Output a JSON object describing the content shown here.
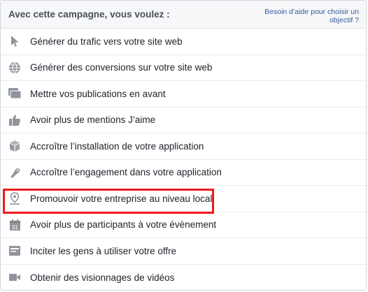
{
  "header": {
    "title": "Avec cette campagne, vous voulez :",
    "help_link": "Besoin d’aide pour choisir un objectif ?"
  },
  "objectives": [
    {
      "label": "Générer du trafic vers votre site web",
      "icon": "cursor-icon"
    },
    {
      "label": "Générer des conversions sur votre site web",
      "icon": "globe-icon"
    },
    {
      "label": "Mettre vos publications en avant",
      "icon": "post-boost-icon"
    },
    {
      "label": "Avoir plus de mentions J’aime",
      "icon": "thumbs-up-icon"
    },
    {
      "label": "Accroître l’installation de votre application",
      "icon": "app-box-icon"
    },
    {
      "label": "Accroître l’engagement dans votre application",
      "icon": "controller-icon"
    },
    {
      "label": "Promouvoir votre entreprise au niveau local",
      "icon": "map-pin-icon",
      "highlighted": true
    },
    {
      "label": "Avoir plus de participants à votre évènement",
      "icon": "calendar-icon"
    },
    {
      "label": "Inciter les gens à utiliser votre offre",
      "icon": "offer-tag-icon"
    },
    {
      "label": "Obtenir des visionnages de vidéos",
      "icon": "video-camera-icon"
    }
  ],
  "colors": {
    "icon": "#90949c",
    "highlight": "#ef1a1a",
    "link": "#365899"
  }
}
